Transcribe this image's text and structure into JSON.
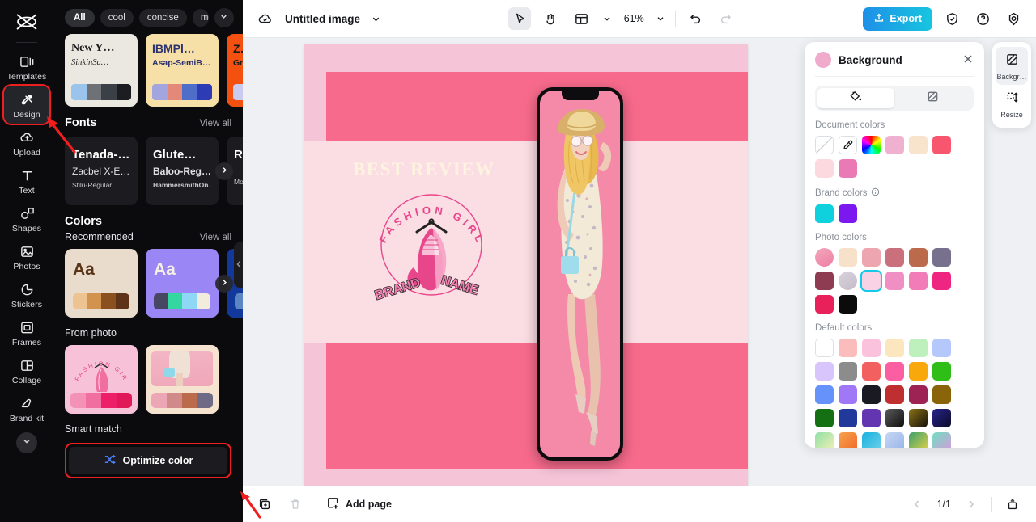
{
  "app": {
    "accent_blue": "#15c9e8",
    "annotation_color": "#f01f1f"
  },
  "left_rail": {
    "logo_name": "capcut-logo",
    "items": [
      {
        "label": "Templates",
        "icon": "templates-icon",
        "active": false
      },
      {
        "label": "Design",
        "icon": "design-icon",
        "active": true,
        "highlighted": true
      },
      {
        "label": "Upload",
        "icon": "upload-cloud-icon",
        "active": false
      },
      {
        "label": "Text",
        "icon": "text-icon",
        "active": false
      },
      {
        "label": "Shapes",
        "icon": "shapes-icon",
        "active": false
      },
      {
        "label": "Photos",
        "icon": "photos-icon",
        "active": false
      },
      {
        "label": "Stickers",
        "icon": "stickers-icon",
        "active": false
      },
      {
        "label": "Frames",
        "icon": "frames-icon",
        "active": false
      },
      {
        "label": "Collage",
        "icon": "collage-icon",
        "active": false
      },
      {
        "label": "Brand kit",
        "icon": "brand-kit-icon",
        "active": false
      }
    ],
    "expand_icon": "chevron-down-icon"
  },
  "panel": {
    "filters": [
      {
        "label": "All",
        "selected": true
      },
      {
        "label": "cool",
        "selected": false
      },
      {
        "label": "concise",
        "selected": false
      },
      {
        "label": "modern",
        "selected": false
      }
    ],
    "filter_more_icon": "chevron-down-icon",
    "templates": [
      {
        "title": "New Y…",
        "subtitle": "SinkinSa…",
        "bg": "#ebe8e2",
        "title_color": "#1b1b1b",
        "sub_color": "#1b1b1b",
        "swatches": [
          "#9bc4ec",
          "#6e7175",
          "#3b4046",
          "#1c1d20"
        ]
      },
      {
        "title": "IBMPl…",
        "subtitle": "Asap-SemiB…",
        "bg": "#f7dfa8",
        "title_color": "#2c3370",
        "sub_color": "#2c3370",
        "swatches": [
          "#a3a5de",
          "#e4887a",
          "#4f6ec9",
          "#2d3bb5"
        ]
      },
      {
        "title": "Z…",
        "subtitle": "Gro…",
        "bg": "#f4500f",
        "title_color": "#1b1b1b",
        "sub_color": "#1b1b1b",
        "swatches": [
          "#c9cbf0",
          "#c9cbf0",
          "#c9cbf0",
          "#c9cbf0"
        ]
      }
    ],
    "fonts_section": {
      "title": "Fonts",
      "view_all": "View all"
    },
    "fonts": [
      {
        "l1": "Tenada-…",
        "l2": "Zacbel X-E…",
        "l3": "Stilu-Regular"
      },
      {
        "l1": "Glute…",
        "l2": "Baloo-Reg…",
        "l3": "HammersmithOn…"
      },
      {
        "l1": "Ru",
        "l2": "",
        "l3": "Mor"
      }
    ],
    "colors_section": {
      "title": "Colors"
    },
    "recommended": {
      "title": "Recommended",
      "view_all": "View all"
    },
    "color_cards": [
      {
        "aa": "Aa",
        "bg": "#e9dccd",
        "fg": "#5a3417",
        "strip": [
          "#eec392",
          "#d1934e",
          "#8a5020",
          "#5d3417"
        ]
      },
      {
        "aa": "Aa",
        "bg": "#9b86f5",
        "fg": "#f4f0e4",
        "strip": [
          "#474763",
          "#35d7a0",
          "#8fd8f5",
          "#f2ecdd"
        ]
      },
      {
        "aa": "A",
        "bg": "#12389c",
        "fg": "#ffffff",
        "strip": [
          "#5b86c4",
          "#5b86c4",
          "#5b86c4",
          "#5b86c4"
        ]
      }
    ],
    "next_arrow_icon": "chevron-right-icon",
    "from_photo": {
      "title": "From photo"
    },
    "photo_palettes": [
      {
        "bg": "#f7c2d8",
        "strip": [
          "#f492b5",
          "#f06fa0",
          "#ec1f68",
          "#e0185a"
        ],
        "alt": "fashion-girl-logo-thumbnail"
      },
      {
        "bg": "#f6e3cf",
        "strip": [
          "#eda6b6",
          "#d18a8a",
          "#bb6a4c",
          "#6f6a85"
        ],
        "alt": "model-photo-thumbnail"
      }
    ],
    "smart_match": {
      "title": "Smart match",
      "button_label": "Optimize color",
      "button_icon": "shuffle-icon"
    },
    "collapse_icon": "chevron-left-icon"
  },
  "topbar": {
    "cloud_icon": "cloud-save-icon",
    "doc_title": "Untitled image",
    "title_caret_icon": "chevron-down-icon",
    "select_tool_icon": "cursor-select-icon",
    "hand_tool_icon": "hand-pan-icon",
    "layout_tool_icon": "layout-grid-icon",
    "layout_caret_icon": "chevron-down-icon",
    "zoom_level": "61%",
    "zoom_caret_icon": "chevron-down-icon",
    "undo_icon": "undo-icon",
    "redo_icon": "redo-icon",
    "export_label": "Export",
    "export_icon": "export-upload-icon",
    "shield_icon": "shield-check-icon",
    "help_icon": "help-circle-icon",
    "settings_icon": "settings-gear-icon"
  },
  "canvas": {
    "headline": "BEST REVIEW",
    "logo_arc_top": "FASHION GIRL",
    "logo_arc_bottom_left": "BRAND",
    "logo_arc_bottom_right": "NAME",
    "bg_color": "#f5c4d7",
    "band_color": "#f76a8c",
    "mid_color": "#fbdde4",
    "headline_color": "#fdf3df",
    "phone_screen_color": "#f58aa8"
  },
  "bottombar": {
    "duplicate_icon": "duplicate-page-icon",
    "delete_icon": "trash-icon",
    "add_page_label": "Add page",
    "add_page_icon": "add-page-icon",
    "prev_icon": "chevron-left-icon",
    "page_indicator": "1/1",
    "next_icon": "chevron-right-icon",
    "pages_panel_icon": "pages-panel-icon"
  },
  "background_panel": {
    "title": "Background",
    "close_icon": "close-icon",
    "tab_fill_icon": "paint-bucket-icon",
    "tab_pattern_icon": "pattern-swatch-icon",
    "document_colors": {
      "label": "Document colors",
      "none_icon": "no-color-icon",
      "picker_icon": "eyedropper-icon",
      "wheel_icon": "color-wheel-icon",
      "swatches": [
        "#f0b0d0",
        "#f8e3cc",
        "#f8566f",
        "#fbd9de",
        "#e97ab6"
      ]
    },
    "brand_colors": {
      "label": "Brand colors",
      "info_icon": "info-icon",
      "swatches": [
        "#0fd0dd",
        "#7b18f0"
      ]
    },
    "photo_colors": {
      "label": "Photo colors",
      "thumbs": [
        "model-photo-thumbnail",
        "fashion-girl-logo-thumbnail"
      ],
      "row1": [
        "#f7e2c9",
        "#eda6b0",
        "#c9707c",
        "#bb6a4c",
        "#77718e",
        "#8d3c51"
      ],
      "row2": [
        "#f9d2e5",
        "#ef8fc4",
        "#f17cb7",
        "#ef2582",
        "#e9215b",
        "#0b0b0b"
      ],
      "selected_index": 0
    },
    "default_colors": {
      "label": "Default colors",
      "rows": [
        [
          "#ffffff",
          "#fbbcbc",
          "#fbc2dd",
          "#fbe6bd",
          "#bdf0bd",
          "#b5c8fb",
          "#d8c5fb"
        ],
        [
          "#8c8c8c",
          "#f26060",
          "#fb5fa1",
          "#f8a80b",
          "#2fbd18",
          "#6592fb",
          "#a077f7"
        ],
        [
          "#1a1b22",
          "#c02f2f",
          "#9c2353",
          "#8a6408",
          "#147012",
          "#22399c",
          "#6335b0"
        ],
        [
          "linear-gradient(135deg,#5a5a5a,#0e0e0e)",
          "linear-gradient(135deg,#8a7317,#161009)",
          "linear-gradient(135deg,#27248c,#0c0b27)",
          "linear-gradient(135deg,#8fe0a6,#f2f0b4)",
          "linear-gradient(135deg,#f8a34c,#f06a2a)",
          "linear-gradient(135deg,#18b1e0,#6fd0e8)",
          "linear-gradient(135deg,#c7d7f4,#96b4e8)"
        ],
        [
          "linear-gradient(135deg,#3aa06a,#e0d04a)",
          "linear-gradient(135deg,#6ee0c0,#d79adc)",
          "linear-gradient(135deg,#a050f0,#40c8f0)",
          "linear-gradient(135deg,#7b4fd0,#ef7fa0)",
          "linear-gradient(135deg,#f58a70,#f0a0c4)",
          "linear-gradient(135deg,#7ac0e8,#ece07a)",
          "linear-gradient(135deg,#9c6ed0,#dda8a0)"
        ]
      ]
    }
  },
  "right_rail": {
    "items": [
      {
        "label": "Backgr…",
        "icon": "background-icon",
        "active": true
      },
      {
        "label": "Resize",
        "icon": "resize-icon",
        "active": false
      }
    ]
  }
}
